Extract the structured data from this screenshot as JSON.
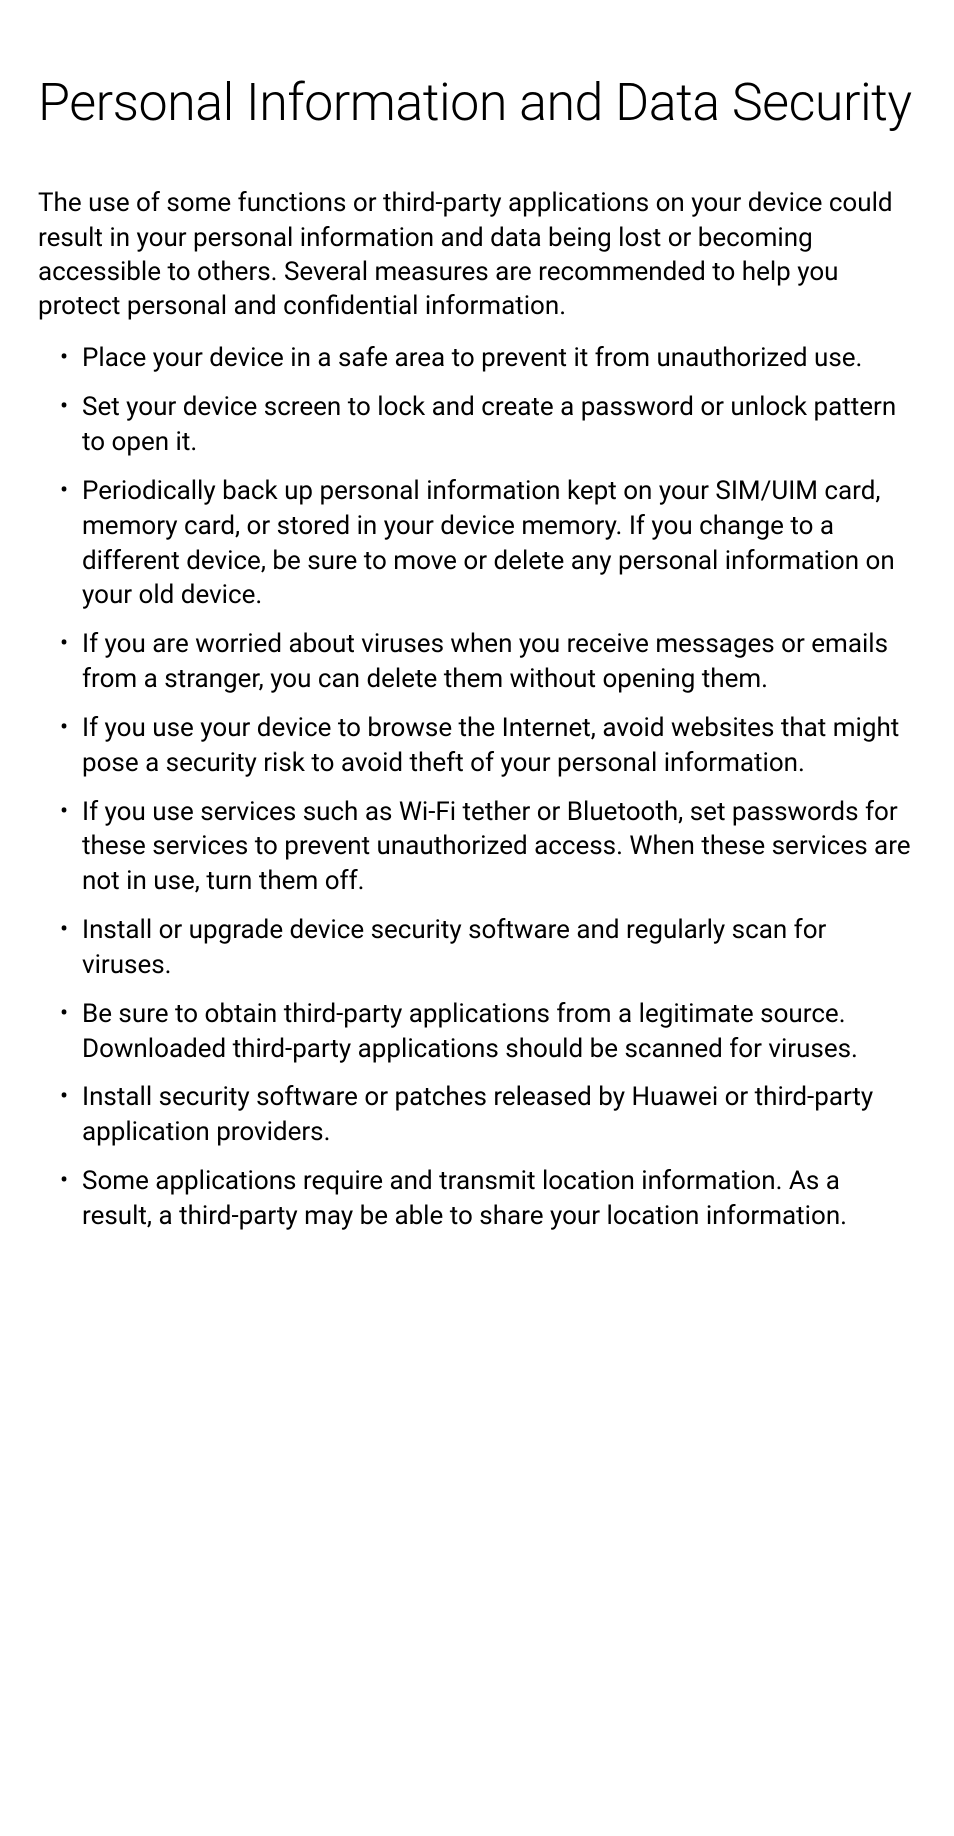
{
  "title": "Personal Information and Data Security",
  "intro": "The use of some functions or third-party applications on your device could result in your personal information and data being lost or becoming accessible to others. Several measures are recommended to help you protect personal and confidential information.",
  "bullets": [
    "Place your device in a safe area to prevent it from unauthorized use.",
    "Set your device screen to lock and create a password or unlock pattern to open it.",
    "Periodically back up personal information kept on your SIM/UIM card, memory card, or stored in your device memory. If you change to a different device, be sure to move or delete any personal information on your old device.",
    "If you are worried about viruses when you receive messages or emails from a stranger, you can delete them without opening them.",
    "If you use your device to browse the Internet, avoid websites that might pose a security risk to avoid theft of your personal information.",
    "If you use services such as Wi-Fi tether or Bluetooth, set passwords for these services to prevent unauthorized access. When these services are not in use, turn them off.",
    "Install or upgrade device security software and regularly scan for viruses.",
    "Be sure to obtain third-party applications from a legitimate source. Downloaded third-party applications should be scanned for viruses.",
    "Install security software or patches released by Huawei or third-party application providers.",
    "Some applications require and transmit location information. As a result, a third-party may be able to share your location information."
  ]
}
